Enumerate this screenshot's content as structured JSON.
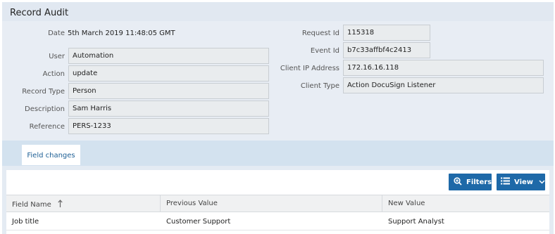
{
  "panel": {
    "title": "Record Audit"
  },
  "details": {
    "date_label": "Date",
    "date_value": "5th March 2019 11:48:05 GMT",
    "user_label": "User",
    "user_value": "Automation",
    "action_label": "Action",
    "action_value": "update",
    "record_type_label": "Record Type",
    "record_type_value": "Person",
    "description_label": "Description",
    "description_value": "Sam Harris",
    "reference_label": "Reference",
    "reference_value": "PERS-1233",
    "request_id_label": "Request Id",
    "request_id_value": "115318",
    "event_id_label": "Event Id",
    "event_id_value": "b7c33affbf4c2413",
    "client_ip_label": "Client IP Address",
    "client_ip_value": "172.16.16.118",
    "client_type_label": "Client Type",
    "client_type_value": "Action DocuSign Listener"
  },
  "tabs": [
    {
      "label": "Field changes",
      "active": true
    }
  ],
  "toolbar": {
    "filters_label": "Filters",
    "view_label": "View",
    "filters_icon": "zoom-in-icon",
    "view_icon": "list-icon",
    "view_chevron": "chevron-down-icon",
    "button_color": "#1e69a8"
  },
  "grid": {
    "columns": [
      {
        "label": "Field Name",
        "sort": "ascending"
      },
      {
        "label": "Previous Value"
      },
      {
        "label": "New Value"
      }
    ],
    "rows": [
      {
        "field_name": "Job title",
        "previous_value": "Customer Support",
        "new_value": "Support Analyst"
      }
    ]
  }
}
